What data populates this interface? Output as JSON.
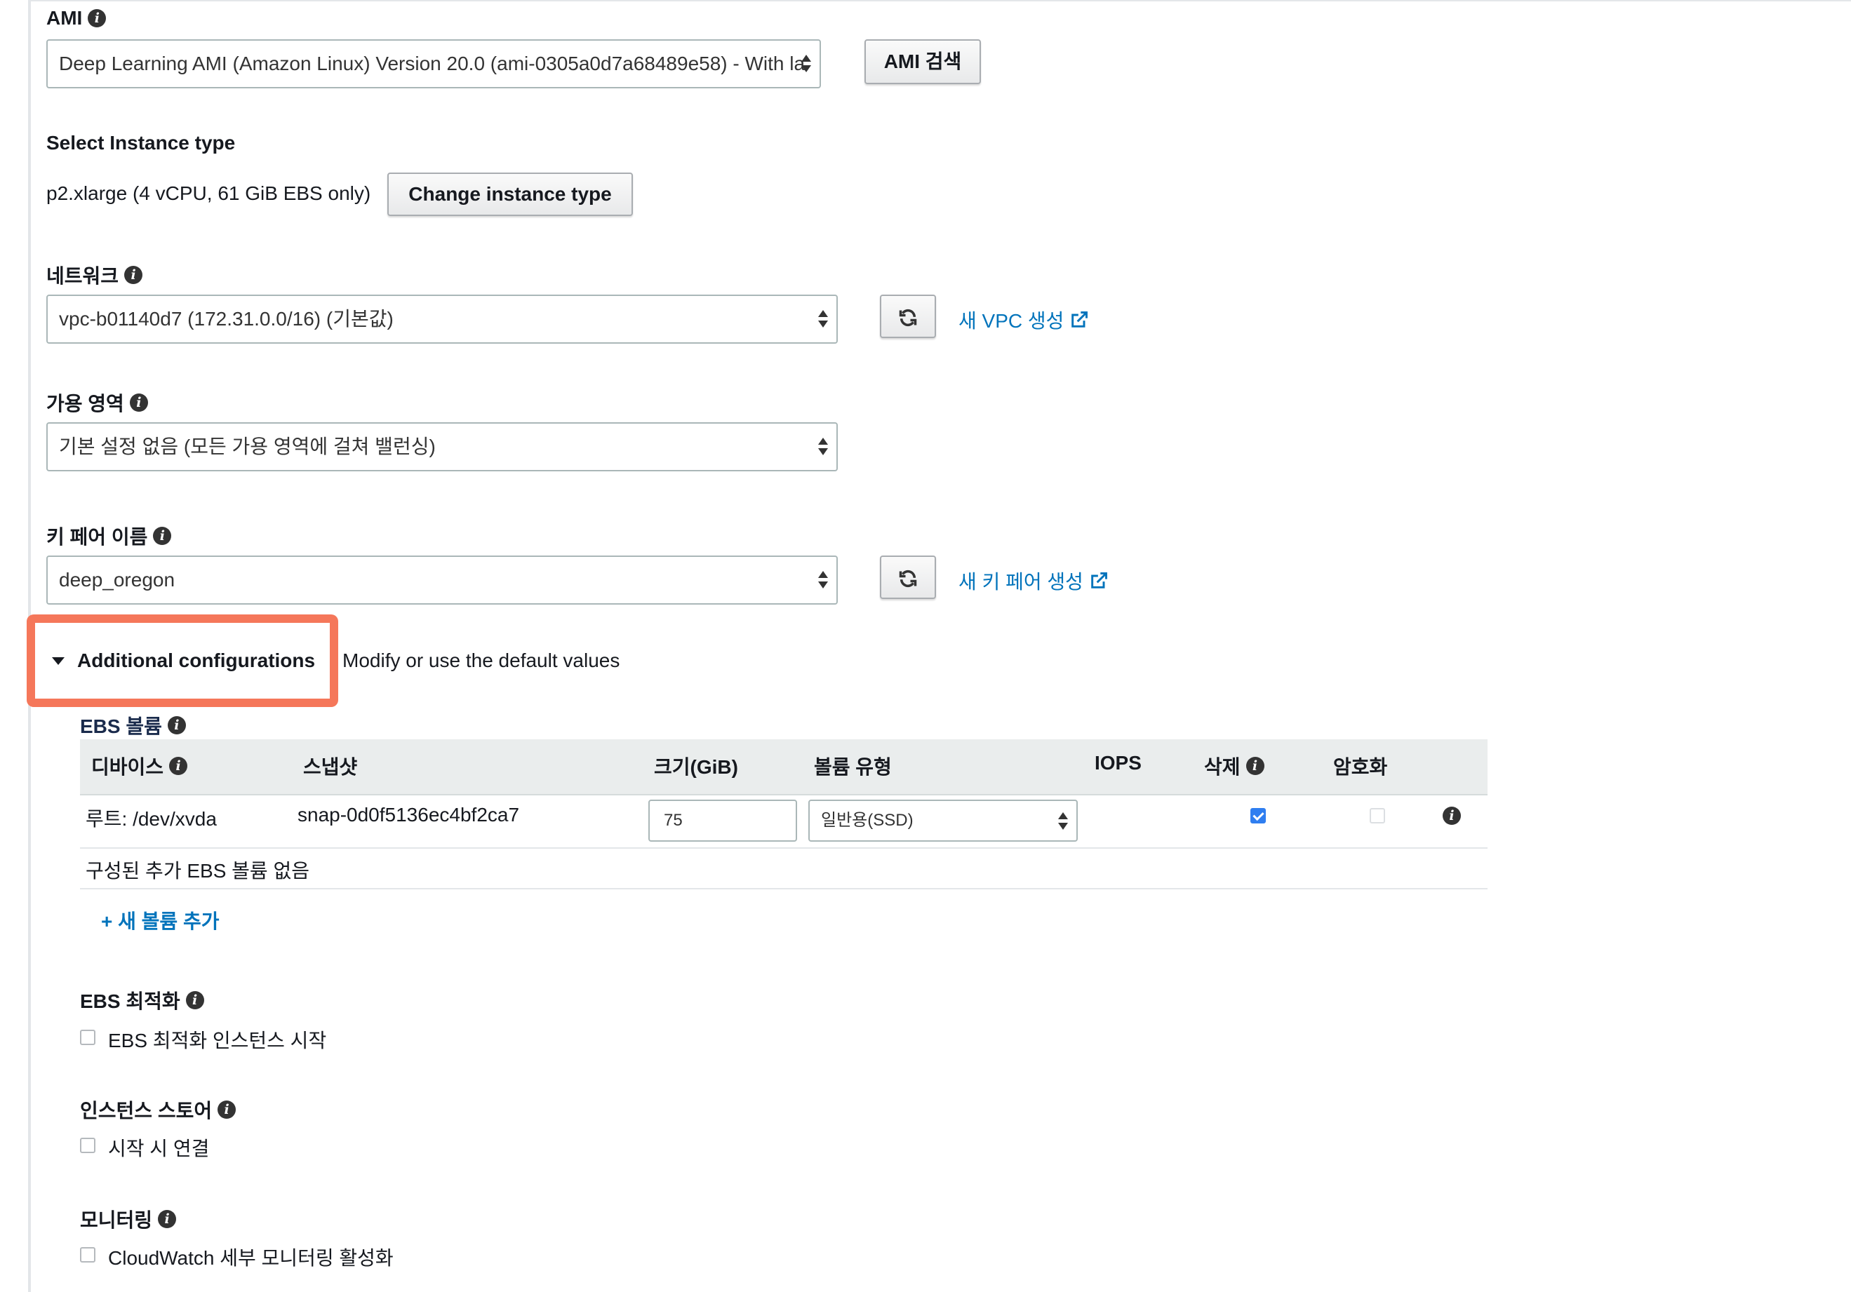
{
  "ami": {
    "label": "AMI",
    "selected": "Deep Learning AMI (Amazon Linux) Version 20.0 (ami-0305a0d7a68489e58) - With la",
    "search_button": "AMI 검색"
  },
  "instance": {
    "label": "Select Instance type",
    "value": "p2.xlarge (4 vCPU, 61 GiB EBS only)",
    "change_button": "Change instance type"
  },
  "network": {
    "label": "네트워크",
    "selected": "vpc-b01140d7 (172.31.0.0/16) (기본값)",
    "create_link": "새 VPC 생성"
  },
  "az": {
    "label": "가용 영역",
    "selected": "기본 설정 없음 (모든 가용 영역에 걸쳐 밸런싱)"
  },
  "keypair": {
    "label": "키 페어 이름",
    "selected": "deep_oregon",
    "create_link": "새 키 페어 생성"
  },
  "additional": {
    "toggle_label": "Additional configurations",
    "description": "Modify or use the default values"
  },
  "ebs": {
    "title": "EBS 볼륨",
    "columns": [
      "디바이스",
      "스냅샷",
      "크기(GiB)",
      "볼륨 유형",
      "IOPS",
      "삭제",
      "암호화"
    ],
    "row": {
      "device": "루트: /dev/xvda",
      "snapshot": "snap-0d0f5136ec4bf2ca7",
      "size": "75",
      "volume_type": "일반용(SSD)",
      "delete_checked": true,
      "encrypt_checked": false
    },
    "empty_message": "구성된 추가 EBS 볼륨 없음",
    "add_link": "+ 새 볼륨 추가"
  },
  "ebs_optimized": {
    "label": "EBS 최적화",
    "checkbox_label": "EBS 최적화 인스턴스 시작"
  },
  "instance_store": {
    "label": "인스턴스 스토어",
    "checkbox_label": "시작 시 연결"
  },
  "monitoring": {
    "label": "모니터링",
    "checkbox_label": "CloudWatch 세부 모니터링 활성화"
  },
  "colors": {
    "link": "#0073bb",
    "highlight": "#f5775a",
    "checkbox_on": "#2f7ef0"
  }
}
